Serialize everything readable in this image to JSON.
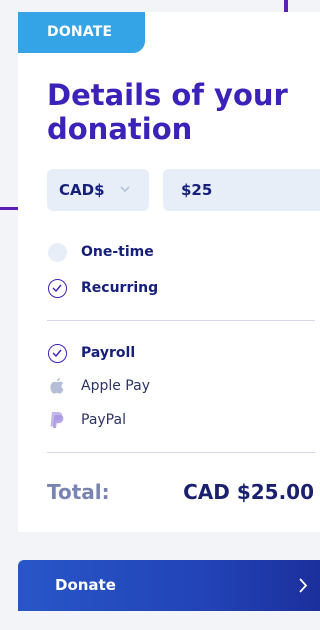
{
  "tag": {
    "label": "DONATE"
  },
  "title": "Details of your donation",
  "currency": {
    "value": "CAD$",
    "icon": "chevron-down-icon"
  },
  "amount": {
    "value": "$25"
  },
  "frequency": {
    "options": [
      {
        "label": "One-time",
        "selected": false
      },
      {
        "label": "Recurring",
        "selected": true
      }
    ]
  },
  "payment": {
    "options": [
      {
        "label": "Payroll",
        "icon": "check-circle-icon",
        "selected": true
      },
      {
        "label": "Apple Pay",
        "icon": "apple-icon",
        "selected": false
      },
      {
        "label": "PayPal",
        "icon": "paypal-icon",
        "selected": false
      }
    ]
  },
  "total": {
    "label": "Total:",
    "value": "CAD $25.00"
  },
  "donate_button": {
    "label": "Donate",
    "icon": "chevron-right-icon"
  },
  "colors": {
    "accent": "#3b22b8",
    "tag": "#34a4e6",
    "button": "#2244b8"
  }
}
